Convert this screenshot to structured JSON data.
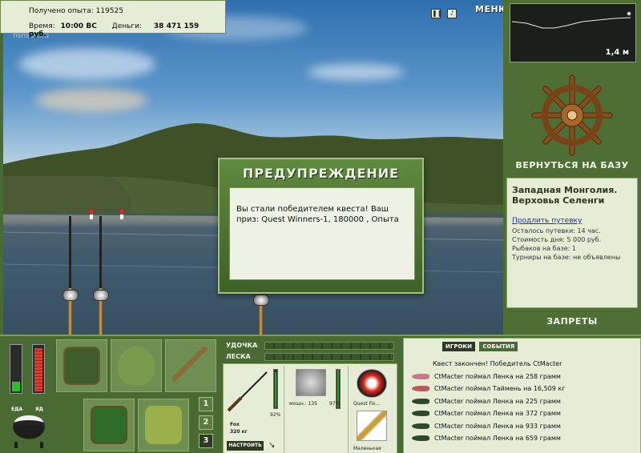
{
  "header": {
    "exp_label": "Получено опыта:",
    "exp_value": "119525",
    "time_label": "Время:",
    "time_value": "10:00 ВС",
    "money_label": "Деньги:",
    "money_value": "38 471 159 руб.",
    "watermark": "fishsoft.ru",
    "menu_label": "МЕНЮ",
    "icon_pause": "pause-icon",
    "icon_sound": "sound-icon"
  },
  "depth": {
    "value": "1,4 м"
  },
  "base": {
    "return_label": "ВЕРНУТЬСЯ НА БАЗУ",
    "location_line1": "Западная Монголия.",
    "location_line2": "Верховья Селенги",
    "extend_link": "Продлить путевку",
    "stats": [
      "Осталось путевки: 14 час.",
      "Стоимость дня: 5 000 руб.",
      "Рыбаков на базе: 1",
      "Турниры на базе: не объявлены"
    ],
    "bans_label": "ЗАПРЕТЫ"
  },
  "dialog": {
    "title": "ПРЕДУПРЕЖДЕНИЕ",
    "message": "Вы стали победителем квеста! Ваш приз: Quest Winners-1, 180000 , Опыта"
  },
  "meters": {
    "food_label": "ЕДА",
    "poison_label": "ЯД",
    "food_level": 0.2,
    "poison_level": 0.9
  },
  "inventory": {
    "pages": [
      "1",
      "2",
      "3"
    ],
    "active_page": "3"
  },
  "tackle": {
    "rod_label": "УДОЧКА",
    "line_label": "ЛЕСКА",
    "rod_name": "Fox",
    "rod_weight": "320 кг",
    "rod_percent": "92%",
    "reel_text": "мощн.: 135",
    "reel_percent": "97%",
    "line_name": "Quest Fis...",
    "bait_name": "Маленькая",
    "setup_label": "НАСТРОИТЬ"
  },
  "chat": {
    "tabs": [
      "ИГРОКИ",
      "СОБЫТИЯ"
    ],
    "messages": [
      {
        "text": "Квест закончен! Победитель CtMacter",
        "fish": "",
        "color": ""
      },
      {
        "text": "CtMacter поймал Ленка на 258 грамм",
        "fish": "lenok",
        "color": "#c87a8a"
      },
      {
        "text": "CtMacter поймал Таймень на 16,509 кг",
        "fish": "taimen",
        "color": "#b85a5a"
      },
      {
        "text": "CtMacter поймал Ленка на 225 грамм",
        "fish": "lenok",
        "color": "#2f4a2a"
      },
      {
        "text": "CtMacter поймал Ленка на 372 грамм",
        "fish": "lenok",
        "color": "#2f4a2a"
      },
      {
        "text": "CtMacter поймал Ленка на 933 грамм",
        "fish": "lenok",
        "color": "#2f4a2a"
      },
      {
        "text": "CtMacter поймал Ленка на 659 грамм",
        "fish": "lenok",
        "color": "#2f4a2a"
      }
    ]
  }
}
